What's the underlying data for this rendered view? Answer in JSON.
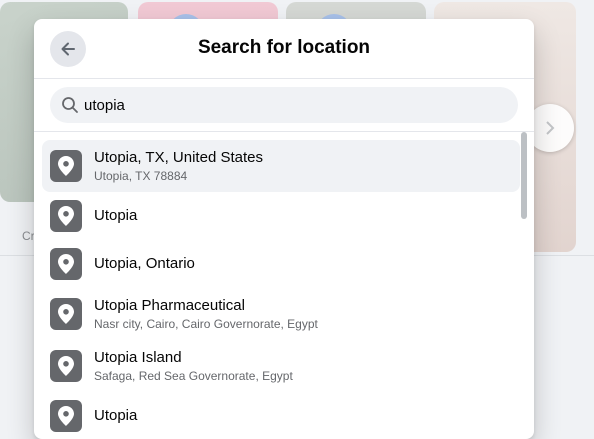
{
  "background": {
    "caption_fragment": "Cr",
    "next_icon": "chevron-right-icon"
  },
  "modal": {
    "title": "Search for location",
    "back_icon": "arrow-left-icon"
  },
  "search": {
    "value": "utopia",
    "icon": "search-icon"
  },
  "results": [
    {
      "name": "Utopia, TX, United States",
      "sub": "Utopia, TX 78884",
      "active": true
    },
    {
      "name": "Utopia",
      "sub": ""
    },
    {
      "name": "Utopia, Ontario",
      "sub": ""
    },
    {
      "name": "Utopia Pharmaceutical",
      "sub": "Nasr city, Cairo, Cairo Governorate, Egypt"
    },
    {
      "name": "Utopia Island",
      "sub": "Safaga, Red Sea Governorate, Egypt"
    },
    {
      "name": "Utopia",
      "sub": ""
    }
  ],
  "result_icon": "map-pin-icon",
  "colors": {
    "tile": "#65676b",
    "active_row": "#f0f2f5"
  }
}
